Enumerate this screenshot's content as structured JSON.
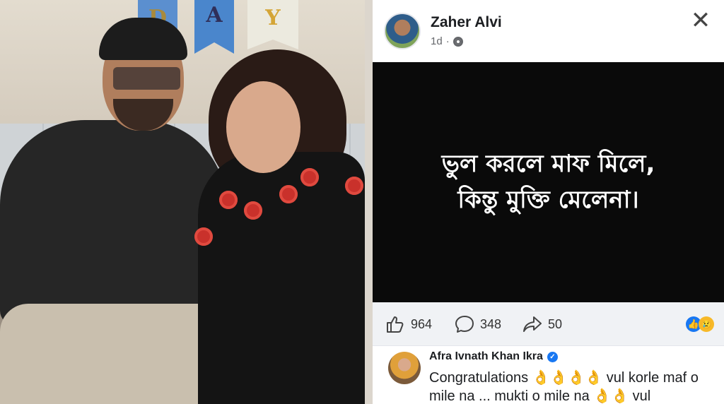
{
  "post": {
    "author": "Zaher Alvi",
    "time": "1d",
    "separator": "·",
    "close_icon": "✕",
    "quote_line1": "ভুল করলে মাফ মিলে,",
    "quote_line2": "কিন্তু মুক্তি মেলেনা।",
    "likes": "964",
    "comments": "348",
    "shares": "50"
  },
  "comment": {
    "author": "Afra Ivnath Khan Ikra",
    "text": "Congratulations 👌👌👌👌 vul korle maf o mile na ... mukti o mile na 👌👌 vul"
  },
  "banner": {
    "letters": [
      "D",
      "A",
      "Y"
    ]
  },
  "colors": {
    "fb_blue": "#1877f2",
    "quote_bg": "#0a0a0a",
    "action_bar_bg": "#f0f2f5"
  },
  "icons": {
    "like": "thumbs-up-icon",
    "comment": "comment-bubble-icon",
    "share": "share-arrow-icon",
    "privacy": "globe-icon",
    "close": "close-icon"
  }
}
